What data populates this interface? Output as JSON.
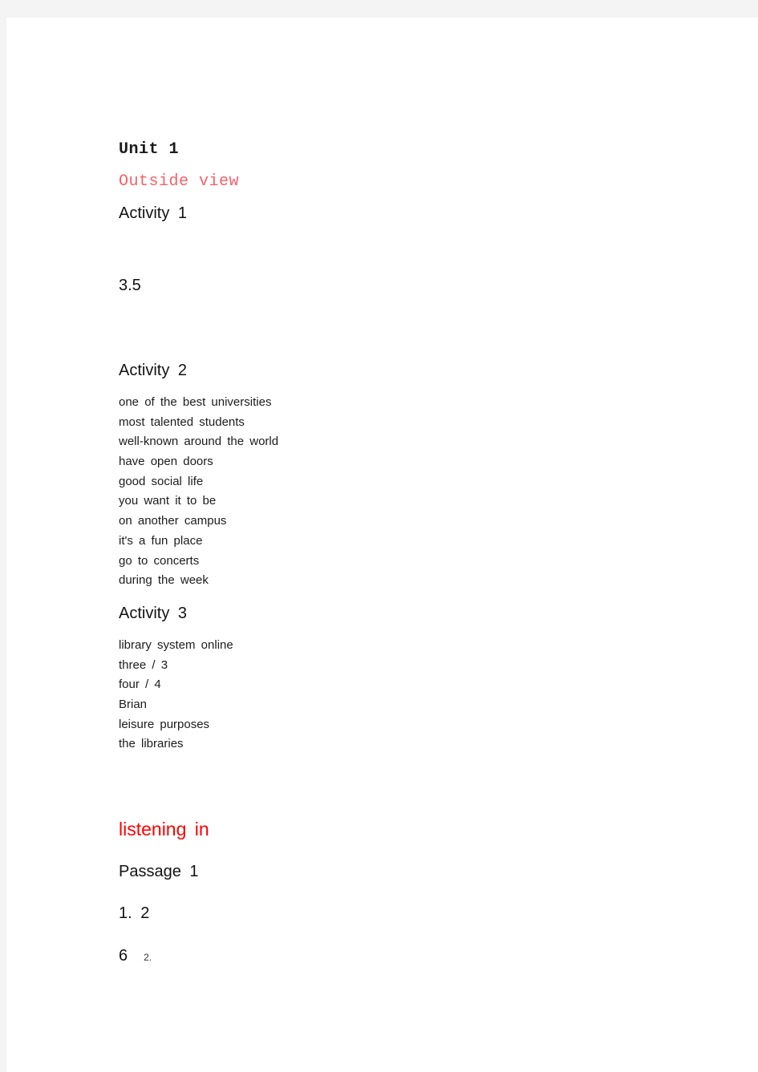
{
  "page": {
    "unit_title": "Unit 1"
  },
  "sections": {
    "outside_view": {
      "heading": "Outside view",
      "color": "#f4616a",
      "activity1": {
        "heading": "Activity  1",
        "answer": "3.5"
      },
      "activity2": {
        "heading": "Activity  2",
        "answers": [
          "one of the best universities",
          "most talented students",
          "well-known around the world",
          "have open doors",
          "good social life",
          "you want it to be",
          "on another campus",
          "it's a fun place",
          "go to concerts",
          "during the week"
        ]
      },
      "activity3": {
        "heading": "Activity  3",
        "answers": [
          "library system online",
          "three / 3",
          "four / 4",
          "Brian",
          "leisure purposes",
          "the libraries"
        ]
      }
    },
    "listening_in": {
      "heading": "listening  in",
      "color": "#ff0000",
      "passage1": {
        "heading": "Passage  1",
        "answer_line": "1.  2",
        "last_line": {
          "big": "6",
          "small": "2."
        }
      }
    }
  }
}
